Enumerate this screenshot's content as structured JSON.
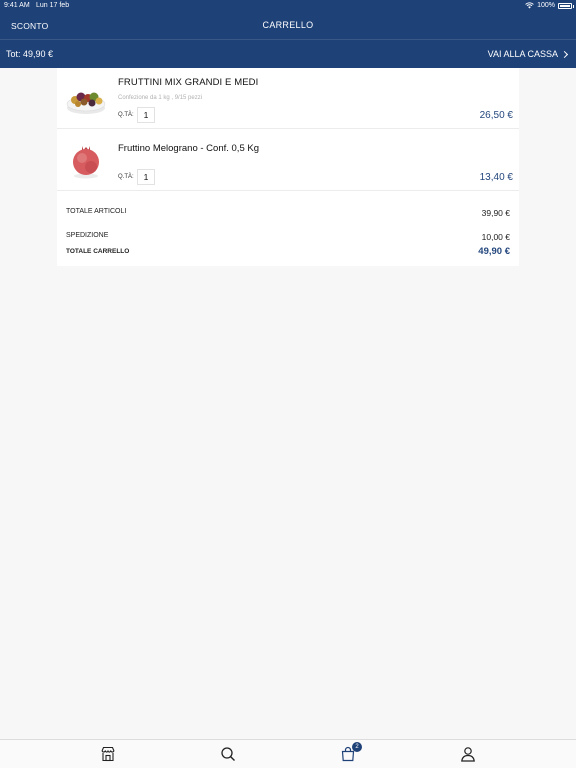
{
  "status_bar": {
    "time": "9:41 AM",
    "date": "Lun 17 feb",
    "battery": "100%"
  },
  "navbar": {
    "left_label": "SCONTO",
    "title": "CARRELLO"
  },
  "subbar": {
    "total": "Tot: 49,90 €",
    "checkout_label": "VAI ALLA CASSA"
  },
  "cart": {
    "items": [
      {
        "name": "FRUTTINI MIX GRANDI E MEDI",
        "description": "Confezione da 1 kg , 9/15 pezzi",
        "qty_label": "Q.TÀ:",
        "qty": "1",
        "price": "26,50 €",
        "image": "mixed-fruit-bowl"
      },
      {
        "name": "Fruttino Melograno - Conf. 0,5 Kg",
        "description": "",
        "qty_label": "Q.TÀ:",
        "qty": "1",
        "price": "13,40 €",
        "image": "pomegranate"
      }
    ],
    "summary": {
      "articles_label": "TOTALE ARTICOLI",
      "articles_value": "39,90 €",
      "shipping_label": "SPEDIZIONE",
      "shipping_value": "10,00 €",
      "total_label": "TOTALE CARRELLO",
      "total_value": "49,90 €"
    }
  },
  "tabbar": {
    "tabs": [
      "shop-icon",
      "search-icon",
      "cart-icon",
      "profile-icon"
    ],
    "cart_badge": "2"
  },
  "colors": {
    "header": "#1e4178",
    "price": "#24477e"
  }
}
